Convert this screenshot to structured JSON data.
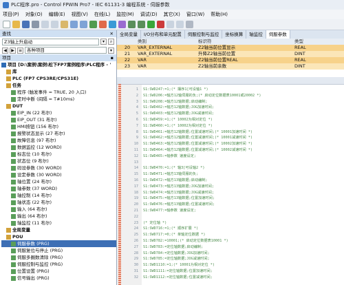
{
  "window": {
    "title": "PLC程序.pro - Control FPWIN Pro7 - IEC 61131-3 编程系统 - 伺服参数"
  },
  "menu": [
    "项目(P)",
    "对象(O)",
    "编辑(E)",
    "视图(V)",
    "在线(L)",
    "监控(M)",
    "调试(D)",
    "其它(X)",
    "窗口(W)",
    "帮助(H)"
  ],
  "left_panel": {
    "search_header": "查找",
    "search_value": "Z3轴上升启动",
    "category_value": "各种项目",
    "project_header": "项目",
    "tree": [
      {
        "label": "项目 [D:\\案例\\案例\\松下FP7案例程序\\PLC程序 - '",
        "level": 0,
        "bold": true
      },
      {
        "label": "库",
        "level": 1,
        "bold": true
      },
      {
        "label": "PLC (FP7 CPS3RE/CPS31E)",
        "level": 1,
        "bold": true
      },
      {
        "label": "任务",
        "level": 1,
        "bold": true
      },
      {
        "label": "程序 (触发事件 = TRUE, 20 入口)",
        "level": 2
      },
      {
        "label": "定时中断 (间隔 = T#10ms)",
        "level": 2
      },
      {
        "label": "DUT",
        "level": 1,
        "bold": true
      },
      {
        "label": "EIP_IN (22 布尔)",
        "level": 2
      },
      {
        "label": "EIP_OUT (31 布尔)",
        "level": 2
      },
      {
        "label": "HMI按钮 (156 布尔)",
        "level": 2
      },
      {
        "label": "报警状态显示 (27 布尔)",
        "level": 2
      },
      {
        "label": "故障信息 (97 布尔)",
        "level": 2
      },
      {
        "label": "数据监控 (12 WORD)",
        "level": 2
      },
      {
        "label": "标志位 (10 布尔)",
        "level": 2
      },
      {
        "label": "状态位 (9 布尔)",
        "level": 2
      },
      {
        "label": "码设参数 (30 WORD)",
        "level": 2
      },
      {
        "label": "设定参数 (30 WORD)",
        "level": 2
      },
      {
        "label": "轴位置 (24 布尔)",
        "level": 2
      },
      {
        "label": "轴参数 (37 WORD)",
        "level": 2
      },
      {
        "label": "轴控制 (14 布尔)",
        "level": 2
      },
      {
        "label": "轴状态 (22 布尔)",
        "level": 2
      },
      {
        "label": "输入 (64 布尔)",
        "level": 2
      },
      {
        "label": "输出 (64 布尔)",
        "level": 2
      },
      {
        "label": "轴监控 (11 布尔)",
        "level": 2
      },
      {
        "label": "全局变量",
        "level": 1,
        "bold": true
      },
      {
        "label": "POU",
        "level": 1,
        "bold": true
      },
      {
        "label": "伺服参数 (PRG)",
        "level": 2,
        "selected": true
      },
      {
        "label": "伺服复位与停止 (PRG)",
        "level": 2
      },
      {
        "label": "伺服多圈数清除 (PRG)",
        "level": 2
      },
      {
        "label": "伺服控制与监控 (PRG)",
        "level": 2
      },
      {
        "label": "位置设置 (PRG)",
        "level": 2
      },
      {
        "label": "信号输出 (PRG)",
        "level": 2
      }
    ]
  },
  "tabs": [
    "全局变量",
    "I/O分布和单元配置",
    "伺服控制与监控",
    "坐标换算",
    "轴监控",
    "伺服参数"
  ],
  "var_table": {
    "headers": [
      "",
      "类别",
      "标识符",
      "类型"
    ],
    "rows": [
      [
        "20",
        "VAR_EXTERNAL",
        "Z2轴当前位置显示",
        "REAL"
      ],
      [
        "21",
        "VAR_EXTERNAL",
        "升降Z2轴当前位置",
        "DINT"
      ],
      [
        "22",
        "VAR",
        "Z2轴当前位置REAL",
        "REAL"
      ],
      [
        "23",
        "VAR",
        "Z2轴当前余数",
        "DINT"
      ]
    ]
  },
  "code_lines": [
    {
      "num": "1",
      "text": "S1:SWD247:=1;(* 摆序1[可设轴1 *)"
    },
    {
      "num": "2",
      "text": "S1:SWD206:=轴方12轴伺服的负;(* 启动定位数据表10001或20002 *)"
    },
    {
      "num": "3",
      "text": "S1:SWD208:=轴方12轴数据;启动编制;"
    },
    {
      "num": "4",
      "text": "S1:SWD402:=轴方12轴数据;JOG加速时间;"
    },
    {
      "num": "5",
      "text": "S1:SWD403:=轴方12轴数据;JOG减速时间;"
    },
    {
      "num": "6",
      "text": "S1:SWD459:=1;(* 10002为相对定位 *)"
    },
    {
      "num": "7",
      "text": "S1:SWD460:=1;(* 10002为相对定位 *)"
    },
    {
      "num": "8",
      "text": "S1:SWD461:=轴方12轴数据;位置减速时间;(* 10001加速时间 *)"
    },
    {
      "num": "9",
      "text": "S1:SWD462:=轴方12轴数据;位置减速时间;(* 10001减速时间 *)"
    },
    {
      "num": "10",
      "text": "S1:SWD463:=轴方12轴数据;位置减速时间;(* 10002加速时间 *)"
    },
    {
      "num": "11",
      "text": "S1:SWD464:=轴方12轴数据;位置减速时间;(* 10002减速时间 *)"
    },
    {
      "num": "12",
      "text": "S1:SWD465:=轴参数 速度设定;"
    },
    {
      "num": "13",
      "text": ""
    },
    {
      "num": "14",
      "text": "S1:SWD470:=1;(* 轴3[可设轴2 *)"
    },
    {
      "num": "15",
      "text": "S1:SWD471:=轴方13轴伺服的负;"
    },
    {
      "num": "16",
      "text": "S1:SWD472:=轴方13轴数据;启动编制;"
    },
    {
      "num": "17",
      "text": "S1:SWD473:=轴方13轴数据;JOG加速时间;"
    },
    {
      "num": "18",
      "text": "S1:SWD474:=轴方13轴数据;JOG减速时间;"
    },
    {
      "num": "19",
      "text": "S1:SWD475:=轴方13轴数据;位置加速时间;"
    },
    {
      "num": "20",
      "text": "S1:SWD476:=轴方13轴数据;位置减速时间;"
    },
    {
      "num": "21",
      "text": "S1:SWD477:=轴参数 速度设定;"
    },
    {
      "num": "22",
      "text": ""
    },
    {
      "num": "23",
      "text": "(* 定位轴 *)"
    },
    {
      "num": "24",
      "text": "S1:SWD716:=1;(* 顺序扩展 *)"
    },
    {
      "num": "25",
      "text": "S1:SWD717:=0;(* 单轴定位数据 *)"
    },
    {
      "num": "26",
      "text": "S1:SWD782:=10001;(* 启动定位数据表10001 *)"
    },
    {
      "num": "27",
      "text": "S1:SWD783:=定位轴数据;启动编制;"
    },
    {
      "num": "28",
      "text": "S1:SWD784:=定位轴数据;JOG加速时间;"
    },
    {
      "num": "29",
      "text": "S1:SWD785:=定位轴数据;JOG减速时间;"
    },
    {
      "num": "30",
      "text": "S1:SWD1110:=1;(* 10001为相对定位 *)"
    },
    {
      "num": "31",
      "text": "S1:SWD1111:=定位轴数据;位置加速时间;"
    },
    {
      "num": "32",
      "text": "S1:SWD1112:=定位轴数据;位置减速时间;"
    }
  ]
}
